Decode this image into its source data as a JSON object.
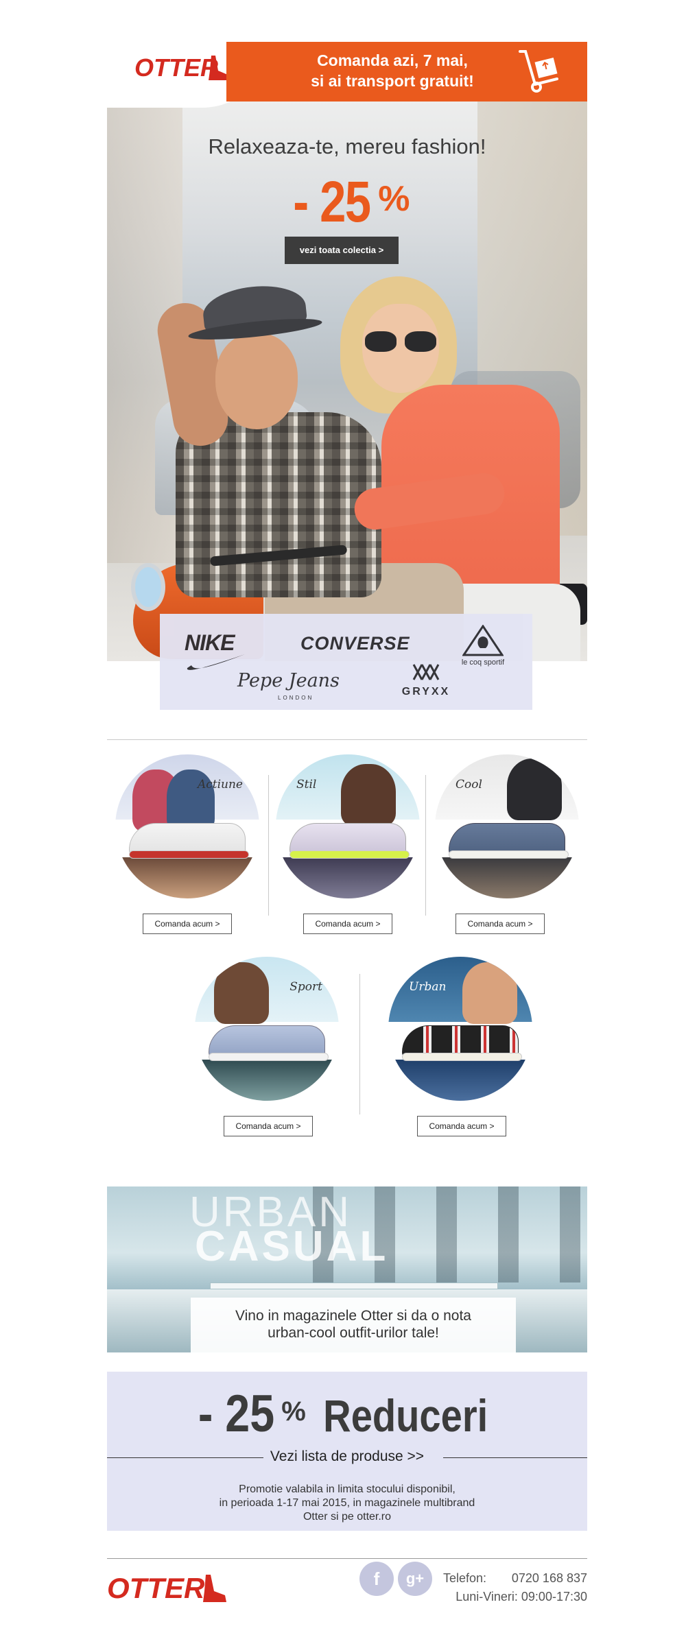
{
  "brand": {
    "logo_text": "OTTER",
    "accent_color": "#ea5a1d"
  },
  "header": {
    "promo_line1": "Comanda azi, 7 mai,",
    "promo_line2": "si ai transport gratuit!"
  },
  "hero": {
    "headline": "Relaxeaza-te, mereu fashion!",
    "discount_value": "- 25",
    "discount_unit": "%",
    "cta_label": "vezi toata colectia >"
  },
  "brands": {
    "nike": "NIKE",
    "converse": "CONVERSE",
    "lecoq": "le coq sportif",
    "pepe": "Pepe Jeans",
    "pepe_sub": "LONDON",
    "gryxx": "GRYXX"
  },
  "categories": [
    {
      "label": "Actiune",
      "button": "Comanda acum >"
    },
    {
      "label": "Stil",
      "button": "Comanda acum >"
    },
    {
      "label": "Cool",
      "button": "Comanda acum >"
    },
    {
      "label": "Sport",
      "button": "Comanda acum >"
    },
    {
      "label": "Urban",
      "button": "Comanda acum >"
    }
  ],
  "urban_banner": {
    "title_line1": "URBAN",
    "title_line2": "CASUAL",
    "caption_line1": "Vino in magazinele Otter si da o nota",
    "caption_line2": "urban-cool outfit-urilor tale!"
  },
  "reduceri": {
    "num": "- 25",
    "pct": "%",
    "word": "Reduceri",
    "link": "Vezi lista de produse >>",
    "terms_line1": "Promotie valabila in limita stocului disponibil,",
    "terms_line2": "in perioada 1-17 mai 2015, in magazinele multibrand",
    "terms_line3": "Otter si pe otter.ro"
  },
  "footer": {
    "facebook": "f",
    "gplus": "g+",
    "phone_label": "Telefon:",
    "phone_value": "0720 168 837",
    "hours": "Luni-Vineri: 09:00-17:30"
  }
}
